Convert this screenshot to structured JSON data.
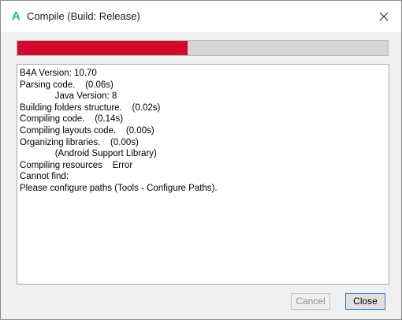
{
  "window": {
    "title": "Compile (Build: Release)",
    "app_icon_glyph": "A",
    "app_icon_color": "#1bb5b0"
  },
  "progress": {
    "value_fraction": 0.46,
    "fill_color": "#d20a2e",
    "track_color": "#d4d4d4"
  },
  "log": {
    "lines": [
      "B4A Version: 10.70",
      "Parsing code.    (0.06s)",
      "              Java Version: 8",
      "Building folders structure.    (0.02s)",
      "Compiling code.    (0.14s)",
      "Compiling layouts code.    (0.00s)",
      "Organizing libraries.    (0.00s)",
      "              (Android Support Library)",
      "Compiling resources    Error",
      "Cannot find:",
      "Please configure paths (Tools - Configure Paths)."
    ]
  },
  "buttons": {
    "cancel_label": "Cancel",
    "close_label": "Close"
  }
}
